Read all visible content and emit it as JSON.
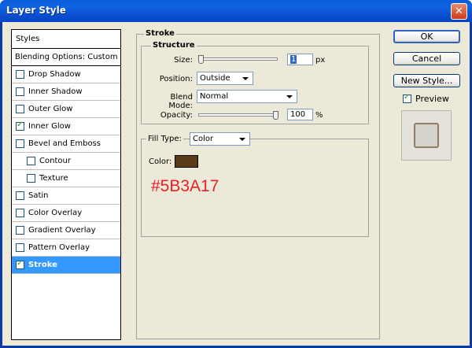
{
  "window": {
    "title": "Layer Style",
    "close_glyph": "✕"
  },
  "styles": {
    "header": "Styles",
    "blending": "Blending Options: Custom",
    "items": [
      {
        "label": "Drop Shadow",
        "checked": false
      },
      {
        "label": "Inner Shadow",
        "checked": false
      },
      {
        "label": "Outer Glow",
        "checked": false
      },
      {
        "label": "Inner Glow",
        "checked": true
      },
      {
        "label": "Bevel and Emboss",
        "checked": false
      },
      {
        "label": "Contour",
        "checked": false
      },
      {
        "label": "Texture",
        "checked": false
      },
      {
        "label": "Satin",
        "checked": false
      },
      {
        "label": "Color Overlay",
        "checked": false
      },
      {
        "label": "Gradient Overlay",
        "checked": false
      },
      {
        "label": "Pattern Overlay",
        "checked": false
      },
      {
        "label": "Stroke",
        "checked": true
      }
    ]
  },
  "stroke": {
    "title": "Stroke",
    "structure_title": "Structure",
    "size_label": "Size:",
    "size_value": "1",
    "size_unit": "px",
    "position_label": "Position:",
    "position_value": "Outside",
    "blend_label": "Blend Mode:",
    "blend_value": "Normal",
    "opacity_label": "Opacity:",
    "opacity_value": "100",
    "opacity_unit": "%",
    "fill_type_label": "Fill Type:",
    "fill_type_value": "Color",
    "color_label": "Color:",
    "color_swatch": "#5B3A17",
    "color_annotation": "#5B3A17",
    "annotation_color": "#e8202a"
  },
  "buttons": {
    "ok": "OK",
    "cancel": "Cancel",
    "new_style": "New Style...",
    "preview_label": "Preview",
    "preview_checked": true
  }
}
